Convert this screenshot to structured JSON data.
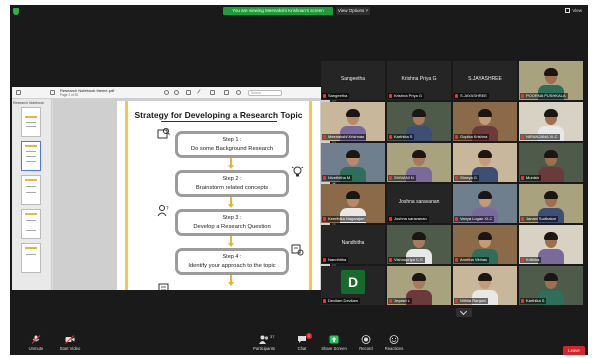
{
  "meeting": {
    "share_banner": "You are viewing Meenakshi Krishnan's screen",
    "view_options": "View Options ˅",
    "view_label": "View"
  },
  "pdf": {
    "file_name": "Research Notebook theme.pdf",
    "page_info": "Page 2 of 25",
    "search_placeholder": "Search",
    "thumb_label": "Research Notebook"
  },
  "document": {
    "title": "Strategy for Developing a Research Topic",
    "steps": [
      {
        "label": "Step 1 :",
        "text": "Do some Background Research"
      },
      {
        "label": "Step 2 :",
        "text": "Brainstorm related concepts"
      },
      {
        "label": "Step 3 :",
        "text": "Develop a Research Question"
      },
      {
        "label": "Step 4 :",
        "text": "Identify your approach to the topic"
      }
    ]
  },
  "participants": [
    {
      "name": "Sangeetha",
      "caption": "Sangeetha",
      "video": false
    },
    {
      "name": "Krishna Priya G",
      "caption": "Krishna Priya G",
      "video": false
    },
    {
      "name": "S.JAYASHREE",
      "caption": "S.JAYASHREE",
      "video": false
    },
    {
      "name": "",
      "caption": "POORNA PUSHKALA",
      "video": true
    },
    {
      "name": "",
      "caption": "Meenakshi Krishnan",
      "video": true,
      "active": true
    },
    {
      "name": "",
      "caption": "Karthika S",
      "video": true
    },
    {
      "name": "",
      "caption": "Gopika Krishna",
      "video": true
    },
    {
      "name": "",
      "caption": "NIRANJANA XI-C",
      "video": true
    },
    {
      "name": "",
      "caption": "Nivethitha M",
      "video": true
    },
    {
      "name": "",
      "caption": "SHIVANI N",
      "video": true
    },
    {
      "name": "",
      "caption": "Shreya G",
      "video": true
    },
    {
      "name": "",
      "caption": "Munish",
      "video": true
    },
    {
      "name": "",
      "caption": "Keerthika Nagarajan",
      "video": true
    },
    {
      "name": "Joshna saravanan",
      "caption": "Joshna saravanan",
      "video": false
    },
    {
      "name": "",
      "caption": "Vanya Logan XI-C",
      "video": true
    },
    {
      "name": "",
      "caption": "Janani Sudhakar",
      "video": true
    },
    {
      "name": "Nandhitha",
      "caption": "Nandhitha",
      "video": false
    },
    {
      "name": "",
      "caption": "Vishnupriya C.S",
      "video": true
    },
    {
      "name": "",
      "caption": "Amritha Vibhas",
      "video": true
    },
    {
      "name": "",
      "caption": "Krithika",
      "video": true
    },
    {
      "name": "",
      "caption": "Devilam Devilam",
      "video": false,
      "avatar": "D"
    },
    {
      "name": "",
      "caption": "Jeyasri L",
      "video": true
    },
    {
      "name": "",
      "caption": "Nithila Ranjani",
      "video": true
    },
    {
      "name": "",
      "caption": "Karthika S",
      "video": true
    }
  ],
  "toolbar": {
    "unmute": "Unmute",
    "start_video": "Start Video",
    "participants": "Participants",
    "participants_count": "37",
    "chat": "Chat",
    "chat_badge": "1",
    "share_screen": "Share Screen",
    "record": "Record",
    "reactions": "Reactions",
    "end": "Leave"
  },
  "colors": {
    "share_green": "#1a9e3a",
    "accent_yellow": "#f2c94c",
    "end_red": "#d9232a"
  }
}
